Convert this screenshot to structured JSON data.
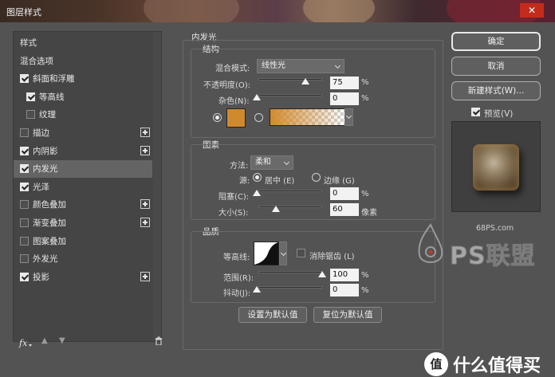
{
  "window": {
    "title": "图层样式",
    "close": "✕"
  },
  "sidebar": {
    "items": [
      {
        "label": "样式",
        "checkbox": null,
        "plus": false,
        "selected": false
      },
      {
        "label": "混合选项",
        "checkbox": null,
        "plus": false,
        "selected": false
      },
      {
        "label": "斜面和浮雕",
        "checkbox": true,
        "plus": false,
        "selected": false
      },
      {
        "label": "等高线",
        "checkbox": true,
        "plus": false,
        "selected": false
      },
      {
        "label": "纹理",
        "checkbox": false,
        "plus": false,
        "selected": false
      },
      {
        "label": "描边",
        "checkbox": false,
        "plus": true,
        "selected": false
      },
      {
        "label": "内阴影",
        "checkbox": true,
        "plus": true,
        "selected": false
      },
      {
        "label": "内发光",
        "checkbox": true,
        "plus": false,
        "selected": true
      },
      {
        "label": "光泽",
        "checkbox": true,
        "plus": false,
        "selected": false
      },
      {
        "label": "颜色叠加",
        "checkbox": false,
        "plus": true,
        "selected": false
      },
      {
        "label": "渐变叠加",
        "checkbox": false,
        "plus": true,
        "selected": false
      },
      {
        "label": "图案叠加",
        "checkbox": false,
        "plus": false,
        "selected": false
      },
      {
        "label": "外发光",
        "checkbox": false,
        "plus": false,
        "selected": false
      },
      {
        "label": "投影",
        "checkbox": true,
        "plus": true,
        "selected": false
      }
    ],
    "fx_label": "fx"
  },
  "panel": {
    "title": "内发光",
    "structure": {
      "heading": "结构",
      "blend_mode_label": "混合模式:",
      "blend_mode_value": "线性光",
      "opacity_label": "不透明度(O):",
      "opacity_value": "75",
      "noise_label": "杂色(N):",
      "noise_value": "0",
      "percent": "%",
      "glow_color": "#d08a2e"
    },
    "elements": {
      "heading": "图素",
      "technique_label": "方法:",
      "technique_value": "柔和",
      "source_label": "源:",
      "source_center": "居中 (E)",
      "source_edge": "边缘 (G)",
      "choke_label": "阻塞(C):",
      "choke_value": "0",
      "size_label": "大小(S):",
      "size_value": "60",
      "px_unit": "像素"
    },
    "quality": {
      "heading": "品质",
      "contour_label": "等高线:",
      "antialias_label": "消除锯齿 (L)",
      "range_label": "范围(R):",
      "range_value": "100",
      "jitter_label": "抖动(J):",
      "jitter_value": "0"
    },
    "set_default": "设置为默认值",
    "reset_default": "复位为默认值"
  },
  "actions": {
    "ok": "确定",
    "cancel": "取消",
    "new_style": "新建样式(W)...",
    "preview": "预览(V)"
  },
  "watermarks": {
    "site": "68PS.com",
    "brand": "PS联盟",
    "zhide": "什么值得买",
    "zhide_badge": "值"
  }
}
